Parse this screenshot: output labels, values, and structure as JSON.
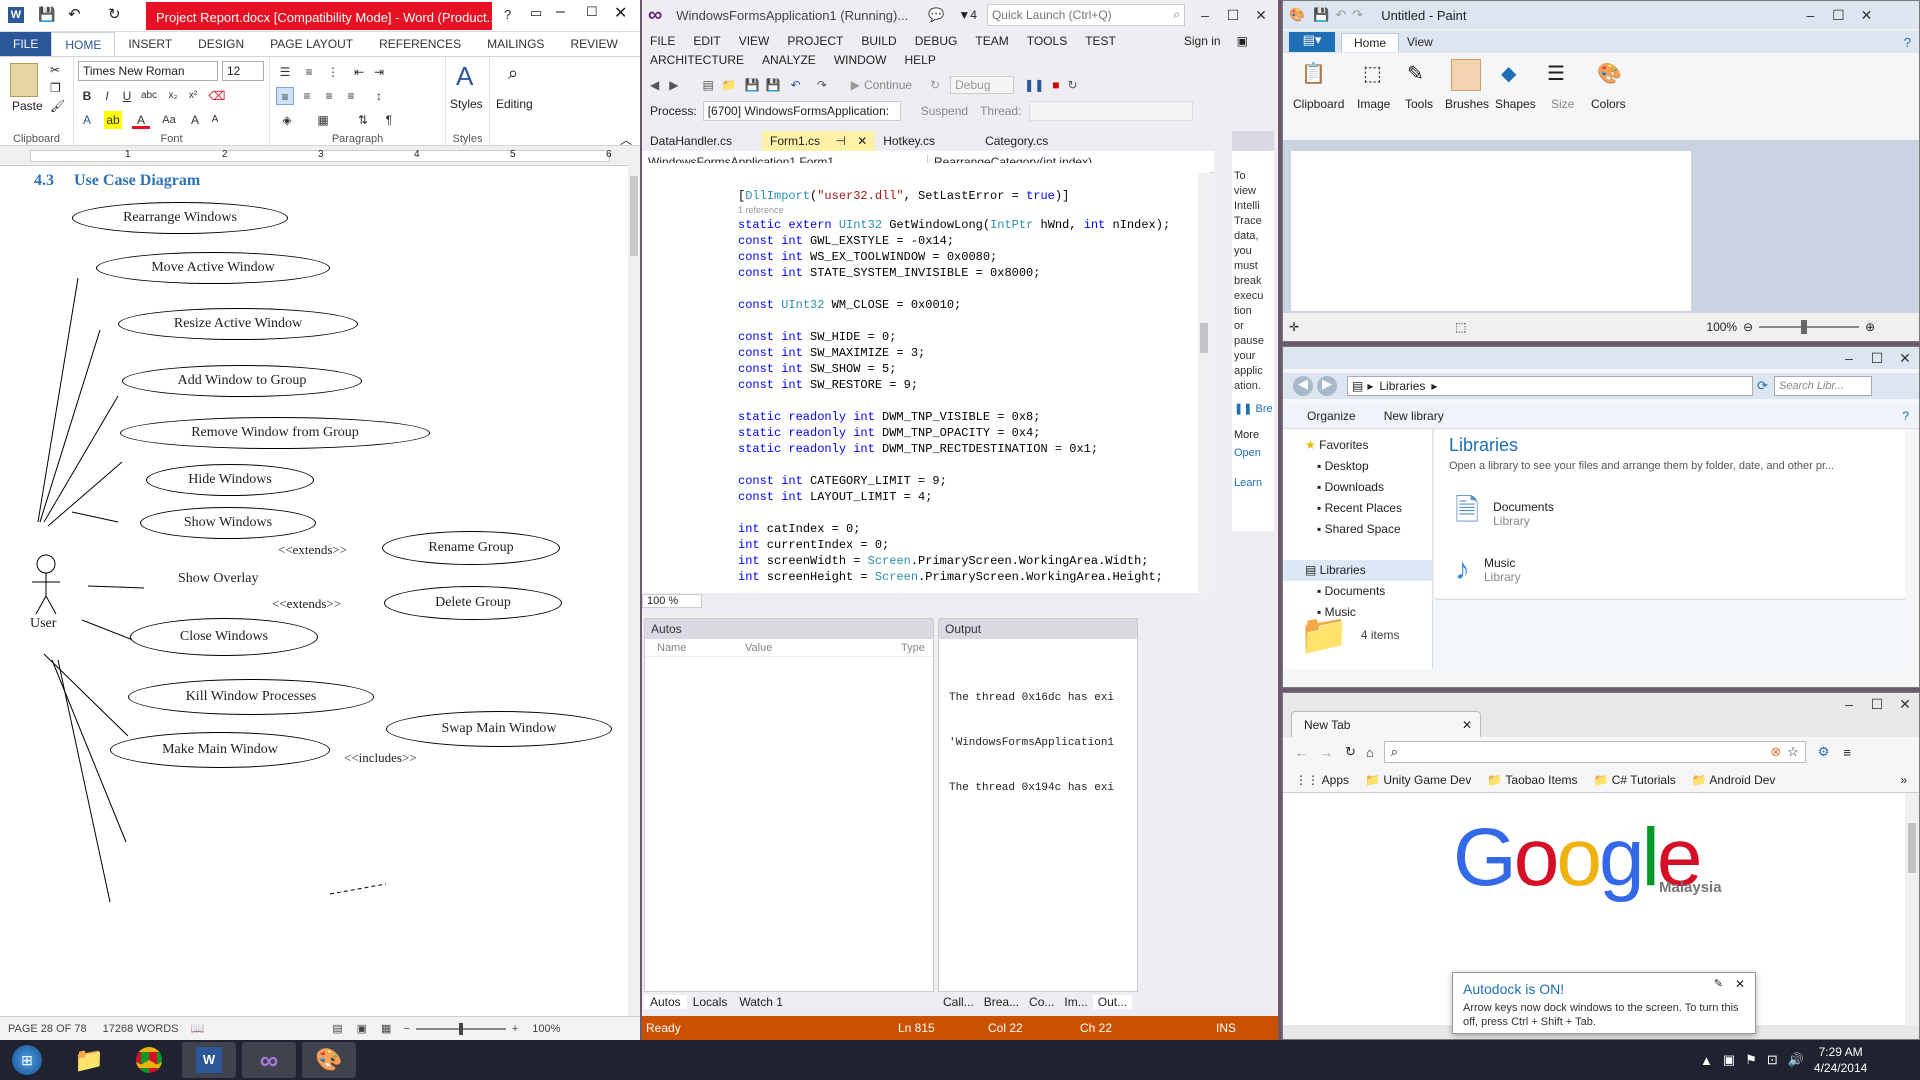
{
  "word": {
    "title": "Project Report.docx [Compatibility Mode] - Word (Product...",
    "help": "?",
    "tabs": [
      "FILE",
      "HOME",
      "INSERT",
      "DESIGN",
      "PAGE LAYOUT",
      "REFERENCES",
      "MAILINGS",
      "REVIEW"
    ],
    "font_name": "Times New Roman",
    "font_size": "12",
    "groups": {
      "clipboard": "Clipboard",
      "font": "Font",
      "paragraph": "Paragraph",
      "styles": "Styles",
      "paste": "Paste",
      "styles_btn": "Styles",
      "editing": "Editing"
    },
    "ruler_numbers": [
      "1",
      "2",
      "3",
      "4",
      "5",
      "6"
    ],
    "heading_num": "4.3",
    "heading_text": "Use Case Diagram",
    "actor": "User",
    "use_cases": [
      "Rearrange Windows",
      "Move Active Window",
      "Resize Active Window",
      "Add Window to Group",
      "Remove Window from Group",
      "Hide Windows",
      "Show Windows",
      "Rename Group",
      "Delete Group",
      "Close Windows",
      "Kill Window Processes",
      "Make Main Window",
      "Swap Main Window"
    ],
    "show_overlay": "Show Overlay",
    "extends1": "<<extends>>",
    "extends2": "<<extends>>",
    "includes": "<<includes>>",
    "status_page": "PAGE 28 OF 78",
    "status_words": "17268 WORDS",
    "zoom": "100%"
  },
  "vs": {
    "title": "WindowsFormsApplication1 (Running)...",
    "notif": "4",
    "quick_launch": "Quick Launch (Ctrl+Q)",
    "menu1": [
      "FILE",
      "EDIT",
      "VIEW",
      "PROJECT",
      "BUILD",
      "DEBUG",
      "TEAM",
      "TOOLS",
      "TEST"
    ],
    "sign_in": "Sign in",
    "menu2": [
      "ARCHITECTURE",
      "ANALYZE",
      "WINDOW",
      "HELP"
    ],
    "continue": "Continue",
    "config": "Debug",
    "process_label": "Process:",
    "process": "[6700] WindowsFormsApplication:",
    "suspend": "Suspend",
    "thread": "Thread:",
    "doc_tabs": [
      "DataHandler.cs",
      "Form1.cs",
      "Hotkey.cs",
      "Category.cs"
    ],
    "class_combo": "WindowsFormsApplication1.Form1",
    "member_combo": "RearrangeCategory(int index)",
    "zoom": "100 %",
    "intellitrace": "To view IntelliTrace data, you must break execution or pause your application.",
    "intellitrace_lines": [
      "To",
      "view",
      "Intelli",
      "Trace",
      "data,",
      "you",
      "must",
      "break",
      "execu",
      "tion",
      "or",
      "pause",
      "your",
      "applic",
      "ation."
    ],
    "break": "Bre",
    "more": "More",
    "open": "Open",
    "learn": "Learn",
    "autos": "Autos",
    "autos_cols": [
      "Name",
      "Value",
      "Type"
    ],
    "output": "Output",
    "output_lines": [
      "The thread 0x16dc has exi",
      "'WindowsFormsApplication1",
      "The thread 0x194c has exi"
    ],
    "bottom_tabs_left": [
      "Autos",
      "Locals",
      "Watch 1"
    ],
    "bottom_tabs_right": [
      "Call...",
      "Brea...",
      "Co...",
      "Im...",
      "Out..."
    ],
    "status_ready": "Ready",
    "status_ln": "Ln 815",
    "status_col": "Col 22",
    "status_ch": "Ch 22",
    "status_ins": "INS",
    "ref_label": "1 reference"
  },
  "paint": {
    "title": "Untitled - Paint",
    "tabs": [
      "Home",
      "View"
    ],
    "groups": [
      "Clipboard",
      "Image",
      "Tools",
      "Brushes",
      "Shapes",
      "Size",
      "Colors"
    ],
    "zoom": "100%"
  },
  "explorer": {
    "crumb": "Libraries",
    "search": "Search Libr...",
    "organize": "Organize",
    "new_library": "New library",
    "favorites": "Favorites",
    "nav": [
      "Desktop",
      "Downloads",
      "Recent Places",
      "Shared Space"
    ],
    "libraries": "Libraries",
    "nav2": [
      "Documents",
      "Music"
    ],
    "heading": "Libraries",
    "subtitle": "Open a library to see your files and arrange them by folder, date, and other pr...",
    "items": [
      {
        "name": "Documents",
        "type": "Library"
      },
      {
        "name": "Music",
        "type": "Library"
      }
    ],
    "count": "4 items"
  },
  "chrome": {
    "tab": "New Tab",
    "bookmarks": [
      "Apps",
      "Unity Game Dev",
      "Taobao Items",
      "C# Tutorials",
      "Android Dev"
    ],
    "logo_sub": "Malaysia"
  },
  "toast": {
    "title": "Autodock is ON!",
    "body": "Arrow keys now dock windows to the screen. To turn this off, press Ctrl + Shift + Tab."
  },
  "taskbar": {
    "time": "7:29 AM",
    "date": "4/24/2014"
  },
  "colors": {
    "word_blue": "#2b579a",
    "vs_orange": "#ca5100",
    "title_red": "#e81123",
    "heading_blue": "#2e74b5"
  }
}
